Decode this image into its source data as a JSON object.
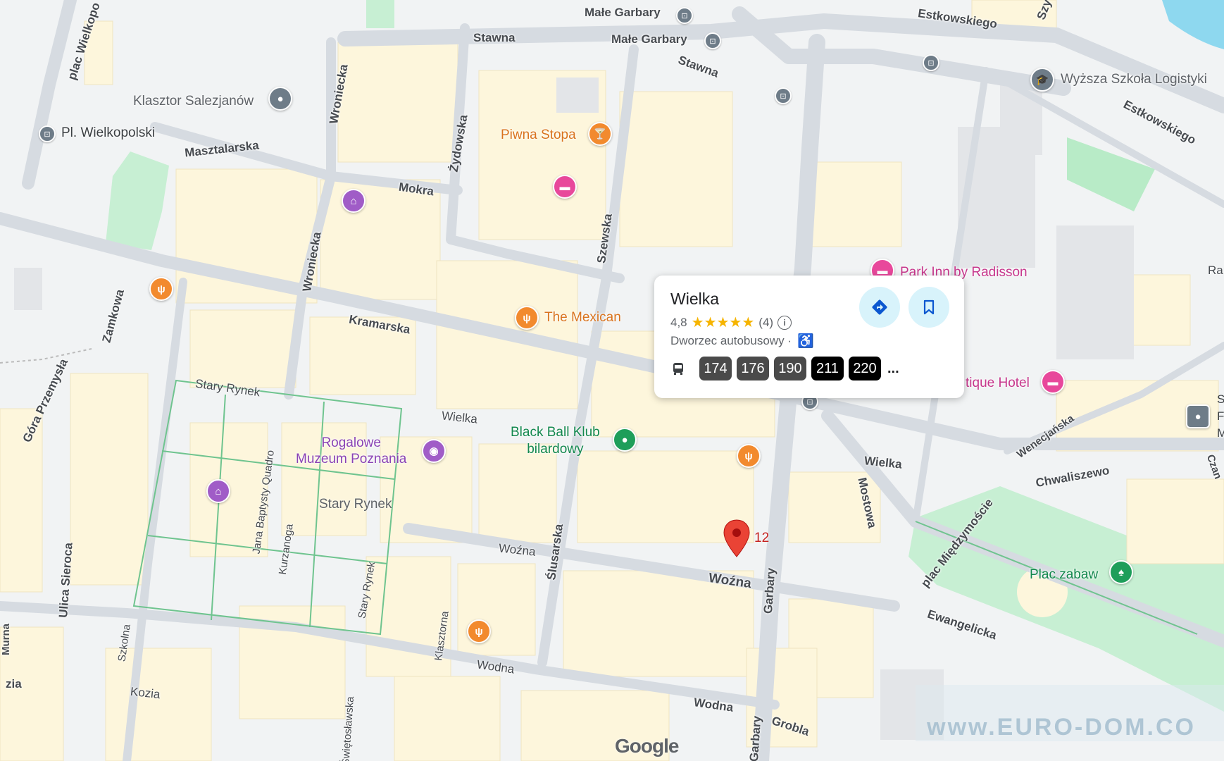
{
  "map": {
    "streets": {
      "male_garbary_1": "Małe Garbary",
      "male_garbary_2": "Małe Garbary",
      "stawna_1": "Stawna",
      "stawna_2": "Stawna",
      "estkowskiego_1": "Estkowskiego",
      "estkowskiego_2": "Estkowskiego",
      "wielkopolski_vertical": "plac Wielkopo",
      "wroniecka_1": "Wroniecka",
      "wroniecka_2": "Wroniecka",
      "zydowska": "Żydowska",
      "masztalarska": "Masztalarska",
      "mokra": "Mokra",
      "szewska": "Szewska",
      "kramarska": "Kramarska",
      "zamkowa": "Zamkowa",
      "gora_przemysla": "Góra Przemysła",
      "stary_rynek_street": "Stary Rynek",
      "stary_rynek_2": "Stary Rynek",
      "wielka_1": "Wielka",
      "wielka_2": "Wielka",
      "jana_baptysty": "Jana Baptysty Quadro",
      "kurzanoga": "Kurzanoga",
      "wozna_1": "Woźna",
      "wozna_2": "Woźna",
      "slusarska": "Ślusarska",
      "garbary_1": "Garbary",
      "garbary_2": "Garbary",
      "mostowa": "Mostowa",
      "chwaliszewo": "Chwaliszewo",
      "wenecjanska": "Wenecjańska",
      "plac_miedzymoscie": "plac Międzymoście",
      "ewangelicka": "Ewangelicka",
      "ulica_sieroca": "Ulica Sieroca",
      "szkolna": "Szkolna",
      "klasztorna": "Klasztorna",
      "wodna_1": "Wodna",
      "wodna_2": "Wodna",
      "kozia": "Kozia",
      "grobla": "Grobla",
      "swietoslawska": "Świętosławska",
      "czan": "Czan",
      "zia": "zia",
      "murna": "Murna",
      "szy": "Szy",
      "ra": "Ra"
    },
    "places": {
      "pl_wielkopolski": "Pl. Wielkopolski",
      "klasztor": "Klasztor Salezjanów",
      "piwna_stopa": "Piwna Stopa",
      "the_mexican": "The Mexican",
      "park_inn": "Park Inn by Radisson",
      "boutique_hotel": "tique Hotel",
      "wyzsza_szkola": "Wyższa Szkoła Logistyki",
      "rogalowe_1": "Rogalowe",
      "rogalowe_2": "Muzeum Poznania",
      "stary_rynek_area": "Stary Rynek",
      "black_ball_1": "Black Ball Klub",
      "black_ball_2": "bilardowy",
      "plac_zabaw": "Plac zabaw",
      "pin_number": "12",
      "s_letter": "S",
      "f_letter": "F",
      "m_letter": "M"
    },
    "info_card": {
      "title": "Wielka",
      "rating_value": "4,8",
      "stars": "★★★★★",
      "review_count": "(4)",
      "category": "Dworzec autobusowy ·",
      "routes": [
        "174",
        "176",
        "190",
        "211",
        "220"
      ],
      "more": "..."
    },
    "branding": {
      "google": "Google",
      "watermark": "www.EURO-DOM.CO"
    }
  }
}
